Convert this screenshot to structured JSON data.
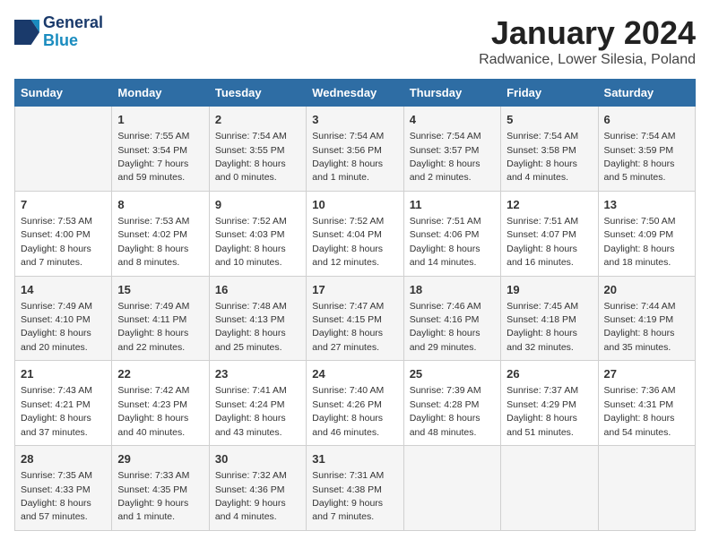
{
  "header": {
    "logo_line1": "General",
    "logo_line2": "Blue",
    "title": "January 2024",
    "subtitle": "Radwanice, Lower Silesia, Poland"
  },
  "days_of_week": [
    "Sunday",
    "Monday",
    "Tuesday",
    "Wednesday",
    "Thursday",
    "Friday",
    "Saturday"
  ],
  "weeks": [
    [
      {
        "day": "",
        "info": ""
      },
      {
        "day": "1",
        "info": "Sunrise: 7:55 AM\nSunset: 3:54 PM\nDaylight: 7 hours\nand 59 minutes."
      },
      {
        "day": "2",
        "info": "Sunrise: 7:54 AM\nSunset: 3:55 PM\nDaylight: 8 hours\nand 0 minutes."
      },
      {
        "day": "3",
        "info": "Sunrise: 7:54 AM\nSunset: 3:56 PM\nDaylight: 8 hours\nand 1 minute."
      },
      {
        "day": "4",
        "info": "Sunrise: 7:54 AM\nSunset: 3:57 PM\nDaylight: 8 hours\nand 2 minutes."
      },
      {
        "day": "5",
        "info": "Sunrise: 7:54 AM\nSunset: 3:58 PM\nDaylight: 8 hours\nand 4 minutes."
      },
      {
        "day": "6",
        "info": "Sunrise: 7:54 AM\nSunset: 3:59 PM\nDaylight: 8 hours\nand 5 minutes."
      }
    ],
    [
      {
        "day": "7",
        "info": "Sunrise: 7:53 AM\nSunset: 4:00 PM\nDaylight: 8 hours\nand 7 minutes."
      },
      {
        "day": "8",
        "info": "Sunrise: 7:53 AM\nSunset: 4:02 PM\nDaylight: 8 hours\nand 8 minutes."
      },
      {
        "day": "9",
        "info": "Sunrise: 7:52 AM\nSunset: 4:03 PM\nDaylight: 8 hours\nand 10 minutes."
      },
      {
        "day": "10",
        "info": "Sunrise: 7:52 AM\nSunset: 4:04 PM\nDaylight: 8 hours\nand 12 minutes."
      },
      {
        "day": "11",
        "info": "Sunrise: 7:51 AM\nSunset: 4:06 PM\nDaylight: 8 hours\nand 14 minutes."
      },
      {
        "day": "12",
        "info": "Sunrise: 7:51 AM\nSunset: 4:07 PM\nDaylight: 8 hours\nand 16 minutes."
      },
      {
        "day": "13",
        "info": "Sunrise: 7:50 AM\nSunset: 4:09 PM\nDaylight: 8 hours\nand 18 minutes."
      }
    ],
    [
      {
        "day": "14",
        "info": "Sunrise: 7:49 AM\nSunset: 4:10 PM\nDaylight: 8 hours\nand 20 minutes."
      },
      {
        "day": "15",
        "info": "Sunrise: 7:49 AM\nSunset: 4:11 PM\nDaylight: 8 hours\nand 22 minutes."
      },
      {
        "day": "16",
        "info": "Sunrise: 7:48 AM\nSunset: 4:13 PM\nDaylight: 8 hours\nand 25 minutes."
      },
      {
        "day": "17",
        "info": "Sunrise: 7:47 AM\nSunset: 4:15 PM\nDaylight: 8 hours\nand 27 minutes."
      },
      {
        "day": "18",
        "info": "Sunrise: 7:46 AM\nSunset: 4:16 PM\nDaylight: 8 hours\nand 29 minutes."
      },
      {
        "day": "19",
        "info": "Sunrise: 7:45 AM\nSunset: 4:18 PM\nDaylight: 8 hours\nand 32 minutes."
      },
      {
        "day": "20",
        "info": "Sunrise: 7:44 AM\nSunset: 4:19 PM\nDaylight: 8 hours\nand 35 minutes."
      }
    ],
    [
      {
        "day": "21",
        "info": "Sunrise: 7:43 AM\nSunset: 4:21 PM\nDaylight: 8 hours\nand 37 minutes."
      },
      {
        "day": "22",
        "info": "Sunrise: 7:42 AM\nSunset: 4:23 PM\nDaylight: 8 hours\nand 40 minutes."
      },
      {
        "day": "23",
        "info": "Sunrise: 7:41 AM\nSunset: 4:24 PM\nDaylight: 8 hours\nand 43 minutes."
      },
      {
        "day": "24",
        "info": "Sunrise: 7:40 AM\nSunset: 4:26 PM\nDaylight: 8 hours\nand 46 minutes."
      },
      {
        "day": "25",
        "info": "Sunrise: 7:39 AM\nSunset: 4:28 PM\nDaylight: 8 hours\nand 48 minutes."
      },
      {
        "day": "26",
        "info": "Sunrise: 7:37 AM\nSunset: 4:29 PM\nDaylight: 8 hours\nand 51 minutes."
      },
      {
        "day": "27",
        "info": "Sunrise: 7:36 AM\nSunset: 4:31 PM\nDaylight: 8 hours\nand 54 minutes."
      }
    ],
    [
      {
        "day": "28",
        "info": "Sunrise: 7:35 AM\nSunset: 4:33 PM\nDaylight: 8 hours\nand 57 minutes."
      },
      {
        "day": "29",
        "info": "Sunrise: 7:33 AM\nSunset: 4:35 PM\nDaylight: 9 hours\nand 1 minute."
      },
      {
        "day": "30",
        "info": "Sunrise: 7:32 AM\nSunset: 4:36 PM\nDaylight: 9 hours\nand 4 minutes."
      },
      {
        "day": "31",
        "info": "Sunrise: 7:31 AM\nSunset: 4:38 PM\nDaylight: 9 hours\nand 7 minutes."
      },
      {
        "day": "",
        "info": ""
      },
      {
        "day": "",
        "info": ""
      },
      {
        "day": "",
        "info": ""
      }
    ]
  ]
}
